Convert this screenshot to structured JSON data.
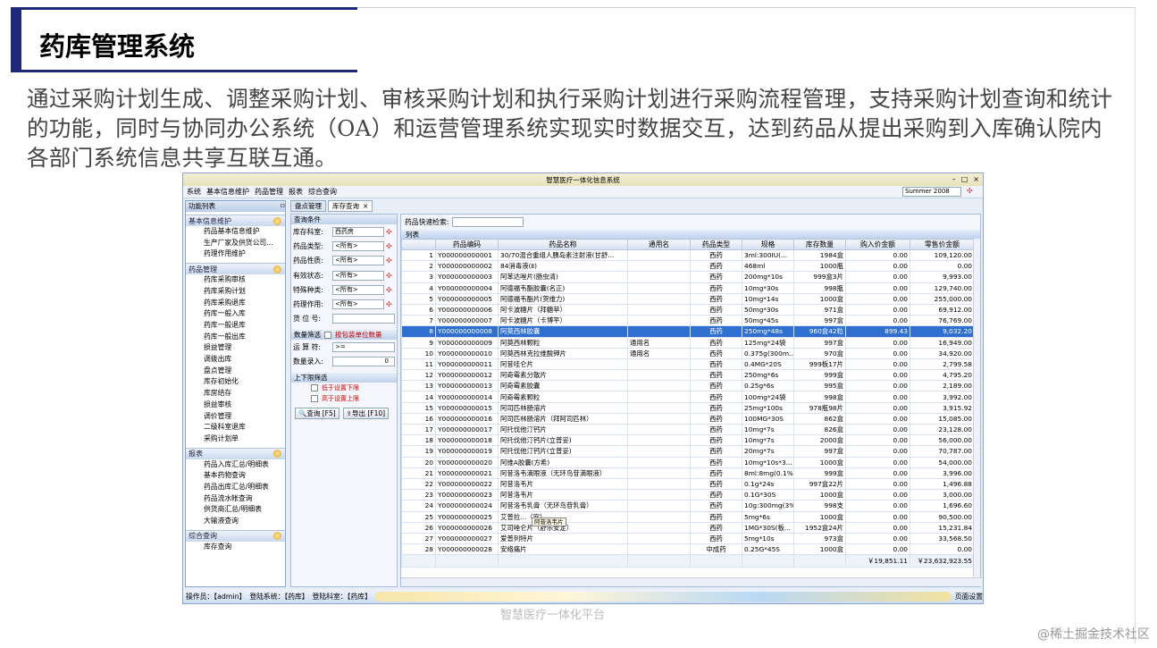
{
  "slide": {
    "title": "药库管理系统",
    "intro": "通过采购计划生成、调整采购计划、审核采购计划和执行采购计划进行采购流程管理，支持采购计划查询和统计的功能，同时与协同办公系统（OA）和运营管理系统实现实时数据交互，达到药品从提出采购到入库确认院内各部门系统信息共享互联互通。",
    "caption": "智慧医疗一体化平台",
    "watermark": "@稀土掘金技术社区"
  },
  "app": {
    "title": "智慧医疗一体化信息系统",
    "menu": [
      "系统",
      "基本信息维护",
      "药品管理",
      "报表",
      "综合查询"
    ],
    "theme": "Summer 2008"
  },
  "nav": {
    "header": "功能列表",
    "groups": [
      {
        "title": "基本信息维护",
        "items": [
          "药品基本信息维护",
          "生产厂家及供货公司...",
          "药理作用维护"
        ]
      },
      {
        "title": "药品管理",
        "items": [
          "药库采购审核",
          "药库采购计划",
          "药库采购退库",
          "药库一般入库",
          "药库一般退库",
          "药库一般出库",
          "损益管理",
          "调拨出库",
          "盘点管理",
          "库存初始化",
          "库房结存",
          "损益审核",
          "调价管理",
          "二级科室退库",
          "采购计划单"
        ]
      },
      {
        "title": "报表",
        "items": [
          "药品入库汇总/明细表",
          "基本药物查询",
          "药品出库汇总/明细表",
          "药品流水帐查询",
          "供货商汇总/明细表",
          "大输液查询"
        ]
      },
      {
        "title": "综合查询",
        "items": [
          "库存查询"
        ]
      }
    ]
  },
  "tabs": [
    "盘点管理",
    "库存查询"
  ],
  "conditions": {
    "header": "查询条件",
    "fields": [
      {
        "label": "库存科室:",
        "value": "西药房"
      },
      {
        "label": "药品类型:",
        "value": "<所有>"
      },
      {
        "label": "药品性质:",
        "value": "<所有>"
      },
      {
        "label": "有效状态:",
        "value": "<所有>"
      },
      {
        "label": "特殊种类:",
        "value": "<所有>"
      },
      {
        "label": "药理作用:",
        "value": "<所有>"
      },
      {
        "label": "货 位 号:",
        "value": ""
      }
    ],
    "qty_header": "数量筛选",
    "qty_check": "按包装单位数量",
    "op_label": "运 算 符:",
    "op_value": ">=",
    "qty_label": "数量录入:",
    "qty_value": "0",
    "limit_header": "上下限筛选",
    "low_limit": "低于设置下限",
    "high_limit": "高于设置上限",
    "query_btn": "查询 [F5]",
    "export_btn": "导出 [F10]"
  },
  "grid": {
    "quick_label": "药品快速检索:",
    "list_label": "列表",
    "tooltip": "阿昔洛韦片",
    "columns": [
      "",
      "药品编码",
      "药品名称",
      "通用名",
      "药品类型",
      "规格",
      "库存数量",
      "购入价金额",
      "零售价金额"
    ],
    "rows": [
      [
        "1",
        "Y000000000001",
        "30/70混合重组人胰岛素注射液(甘舒...",
        "",
        "西药",
        "3ml:300IU(...",
        "1984盒",
        "0.00",
        "109,120.00"
      ],
      [
        "2",
        "Y000000000002",
        "84消毒液(Ⅱ)",
        "",
        "西药",
        "468ml",
        "1000瓶",
        "0.00",
        "0.00"
      ],
      [
        "3",
        "Y000000000003",
        "阿苯达唑片(肠虫清)",
        "",
        "西药",
        "200mg*10s",
        "999盒3片",
        "0.00",
        "9,993.00"
      ],
      [
        "4",
        "Y000000000004",
        "阿德福韦酯胶囊(名正)",
        "",
        "西药",
        "10mg*30s",
        "998瓶",
        "0.00",
        "129,740.00"
      ],
      [
        "5",
        "Y000000000005",
        "阿德福韦酯片(贺维力)",
        "",
        "西药",
        "10mg*14s",
        "1000盒",
        "0.00",
        "255,000.00"
      ],
      [
        "6",
        "Y000000000006",
        "阿卡波糖片（拜糖苹）",
        "",
        "西药",
        "50mg*30s",
        "971盒",
        "0.00",
        "69,912.00"
      ],
      [
        "7",
        "Y000000000007",
        "阿卡波糖片（卡博平）",
        "",
        "西药",
        "50mg*45s",
        "997盒",
        "0.00",
        "76,769.00"
      ],
      [
        "8",
        "Y000000000008",
        "阿莫西林胶囊",
        "",
        "西药",
        "250mg*48s",
        "960盒42粒",
        "899.43",
        "9,032.20"
      ],
      [
        "9",
        "Y000000000009",
        "阿莫西林颗粒",
        "通用名",
        "西药",
        "125mg*24袋",
        "997盒",
        "0.00",
        "16,949.00"
      ],
      [
        "10",
        "Y000000000010",
        "阿莫西林克拉维酸钾片",
        "通用名",
        "西药",
        "0.375g(300m...",
        "970盒",
        "0.00",
        "34,920.00"
      ],
      [
        "11",
        "Y000000000011",
        "阿昔哇仑片",
        "",
        "西药",
        "0.4MG*20S",
        "999板17片",
        "0.00",
        "2,799.58"
      ],
      [
        "12",
        "Y000000000012",
        "阿奇霉素分散片",
        "",
        "西药",
        "250mg*6s",
        "999盒",
        "0.00",
        "4,795.20"
      ],
      [
        "13",
        "Y000000000013",
        "阿奇霉素胶囊",
        "",
        "西药",
        "0.25g*6s",
        "995盒",
        "0.00",
        "2,189.00"
      ],
      [
        "14",
        "Y000000000014",
        "阿奇霉素颗粒",
        "",
        "西药",
        "100mg*24袋",
        "998盒",
        "0.00",
        "3,992.00"
      ],
      [
        "15",
        "Y000000000015",
        "阿司匹林肠溶片",
        "",
        "西药",
        "25mg*100s",
        "978瓶98片",
        "0.00",
        "3,915.92"
      ],
      [
        "16",
        "Y000000000016",
        "阿司匹林肠溶片（拜阿司匹林）",
        "",
        "西药",
        "100MG*30S",
        "862盒",
        "0.00",
        "15,085.00"
      ],
      [
        "17",
        "Y000000000017",
        "阿托伐他汀钙片",
        "",
        "西药",
        "10mg*7s",
        "826盒",
        "0.00",
        "23,128.00"
      ],
      [
        "18",
        "Y000000000018",
        "阿托伐他汀钙片(立普妥)",
        "",
        "西药",
        "10mg*7s",
        "2000盒",
        "0.00",
        "56,000.00"
      ],
      [
        "19",
        "Y000000000019",
        "阿托伐他汀钙片(立普妥)",
        "",
        "西药",
        "20mg*7s",
        "997盒",
        "0.00",
        "70,787.00"
      ],
      [
        "20",
        "Y000000000020",
        "阿维A胶囊(方希)",
        "",
        "西药",
        "10mg*10s*3...",
        "1000盒",
        "0.00",
        "54,000.00"
      ],
      [
        "21",
        "Y000000000021",
        "阿昔洛韦滴眼液（无环鸟苷滴眼液）",
        "",
        "西药",
        "8ml:8mg(0.1%)",
        "999盒",
        "0.00",
        "3,996.00"
      ],
      [
        "22",
        "Y000000000022",
        "阿昔洛韦片",
        "",
        "西药",
        "0.1g*24s",
        "997盒22片",
        "0.00",
        "1,496.88"
      ],
      [
        "23",
        "Y000000000023",
        "阿昔洛韦片",
        "",
        "西药",
        "0.1G*30S",
        "1000盒",
        "0.00",
        "3,000.00"
      ],
      [
        "24",
        "Y000000000024",
        "阿昔洛韦乳膏（无环鸟苷乳膏）",
        "",
        "西药",
        "10g:300mg(3%)",
        "998支",
        "0.00",
        "1,696.60"
      ],
      [
        "25",
        "Y000000000025",
        "艾普拉...（安）",
        "",
        "西药",
        "5mg*6s",
        "1000盒",
        "0.00",
        "90,500.00"
      ],
      [
        "26",
        "Y000000000026",
        "艾司唑仑片（舒乐安定）",
        "",
        "西药",
        "1MG*30S(板...",
        "1952盒24片",
        "0.00",
        "15,231.84"
      ],
      [
        "27",
        "Y000000000027",
        "爱普列特片",
        "",
        "西药",
        "5mg*10s",
        "973盒",
        "0.00",
        "33,568.50"
      ],
      [
        "28",
        "Y000000000028",
        "安络痛片",
        "",
        "中成药",
        "0.25G*45S",
        "1000盒",
        "0.00",
        "0.00"
      ]
    ],
    "totals": {
      "purchase": "￥19,851.11",
      "retail": "￥23,632,923.55"
    }
  },
  "status": {
    "operator": "操作员：【admin】",
    "system": "登陆系统：【药库】",
    "dept": "登陆科室：【药库】",
    "page_setup": "页面设置"
  }
}
